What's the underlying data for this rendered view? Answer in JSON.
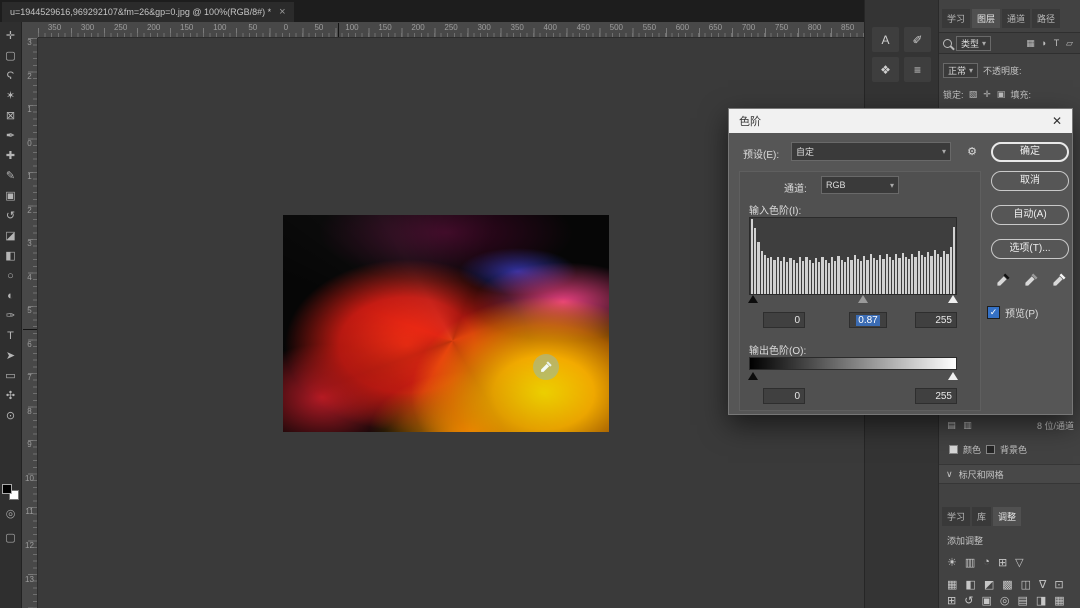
{
  "colors": {
    "accent_blue": "#3b6cb4",
    "dialog_bg": "#565656",
    "canvas_bg": "#3a3a3a"
  },
  "ui": {
    "dropdown_arrow": "▾",
    "check": "✓",
    "depth_icon1": "▤",
    "depth_icon2": "▥"
  },
  "window": {
    "doc_tab_title": "u=1944529616,969292107&fm=26&gp=0.jpg @ 100%(RGB/8#) *",
    "tab_close": "×"
  },
  "rulers": {
    "h_labels": [
      "350",
      "300",
      "250",
      "200",
      "150",
      "100",
      "50",
      "0",
      "50",
      "100",
      "150",
      "200",
      "250",
      "300",
      "350",
      "400",
      "450",
      "500",
      "550",
      "600",
      "650",
      "700",
      "750",
      "800",
      "850"
    ],
    "v_labels": [
      "3",
      "2",
      "1",
      "0",
      "1",
      "2",
      "3",
      "4",
      "5",
      "6",
      "7",
      "8",
      "9",
      "10",
      "11",
      "12",
      "13"
    ]
  },
  "toolbar": {
    "quick_mask_glyph": "◎",
    "screen_mode_glyph": "▢",
    "tools": [
      {
        "name": "move-tool-icon",
        "glyph": "✛"
      },
      {
        "name": "marquee-tool-icon",
        "glyph": "▢"
      },
      {
        "name": "lasso-tool-icon",
        "glyph": "Ϛ"
      },
      {
        "name": "quick-selection-tool-icon",
        "glyph": "✶"
      },
      {
        "name": "crop-tool-icon",
        "glyph": "⊠"
      },
      {
        "name": "eyedropper-tool-icon",
        "glyph": "✒"
      },
      {
        "name": "healing-brush-tool-icon",
        "glyph": "✚"
      },
      {
        "name": "brush-tool-icon",
        "glyph": "✎"
      },
      {
        "name": "clone-stamp-tool-icon",
        "glyph": "▣"
      },
      {
        "name": "history-brush-tool-icon",
        "glyph": "↺"
      },
      {
        "name": "eraser-tool-icon",
        "glyph": "◪"
      },
      {
        "name": "gradient-tool-icon",
        "glyph": "◧"
      },
      {
        "name": "blur-tool-icon",
        "glyph": "○"
      },
      {
        "name": "dodge-tool-icon",
        "glyph": "◐"
      },
      {
        "name": "pen-tool-icon",
        "glyph": "✑"
      },
      {
        "name": "type-tool-icon",
        "glyph": "T"
      },
      {
        "name": "path-selection-tool-icon",
        "glyph": "➤"
      },
      {
        "name": "shape-tool-icon",
        "glyph": "▭"
      },
      {
        "name": "hand-tool-icon",
        "glyph": "✣"
      },
      {
        "name": "zoom-tool-icon",
        "glyph": "⊙"
      }
    ]
  },
  "side_strip": {
    "icons": [
      {
        "name": "character-panel-icon",
        "glyph": "A"
      },
      {
        "name": "brush-settings-panel-icon",
        "glyph": "✐"
      },
      {
        "name": "3d-panel-icon",
        "glyph": "❖"
      },
      {
        "name": "properties-panel-icon",
        "glyph": "≡"
      }
    ]
  },
  "panels": {
    "top_tabs": [
      {
        "name": "tab-learn",
        "label": "学习"
      },
      {
        "name": "tab-layers",
        "label": "图层",
        "active": true
      },
      {
        "name": "tab-channels",
        "label": "通道"
      },
      {
        "name": "tab-paths",
        "label": "路径"
      }
    ],
    "filter_label": "类型",
    "filter_icons": [
      {
        "name": "filter-pixel-layers-icon",
        "glyph": "▦"
      },
      {
        "name": "filter-adjustment-layers-icon",
        "glyph": "◑"
      },
      {
        "name": "filter-type-layers-icon",
        "glyph": "T"
      },
      {
        "name": "filter-shape-layers-icon",
        "glyph": "▱"
      }
    ],
    "blend_mode": "正常",
    "opacity_label": "不透明度:",
    "lock_label": "锁定:",
    "lock_icons": [
      {
        "name": "lock-transparent-pixels-icon",
        "glyph": "▧"
      },
      {
        "name": "lock-position-icon",
        "glyph": "✛"
      },
      {
        "name": "lock-all-icon",
        "glyph": "▣"
      }
    ],
    "fill_label": "填充:",
    "bit_depth": "8 位/通道",
    "color_label": "颜色",
    "bg_color_label": "背景色",
    "chevron": "∨",
    "rulers_grid_label": "标尺和网格",
    "bottom_tabs": [
      {
        "name": "tab-learn-2",
        "label": "学习"
      },
      {
        "name": "tab-libraries",
        "label": "库"
      },
      {
        "name": "tab-adjustments",
        "label": "调整",
        "active": true
      }
    ],
    "add_adjustment_label": "添加调整",
    "adjustment_icons_row1": [
      {
        "name": "brightness-contrast-icon",
        "glyph": "☀"
      },
      {
        "name": "levels-adjustment-icon",
        "glyph": "▥"
      },
      {
        "name": "curves-adjustment-icon",
        "glyph": "◔"
      },
      {
        "name": "exposure-adjustment-icon",
        "glyph": "⊞"
      },
      {
        "name": "vibrance-adjustment-icon",
        "glyph": "▽"
      }
    ],
    "adjustment_icons_row2": [
      {
        "name": "hue-saturation-icon",
        "glyph": "▦"
      },
      {
        "name": "color-balance-icon",
        "glyph": "◧"
      },
      {
        "name": "black-white-icon",
        "glyph": "◩"
      },
      {
        "name": "photo-filter-icon",
        "glyph": "▩"
      },
      {
        "name": "channel-mixer-icon",
        "glyph": "◫"
      },
      {
        "name": "gradient-map-icon",
        "glyph": "∇"
      },
      {
        "name": "selective-color-icon",
        "glyph": "⊡"
      }
    ],
    "panel_action_icons": [
      {
        "name": "link-layers-icon",
        "glyph": "⊞"
      },
      {
        "name": "layer-effects-icon",
        "glyph": "↺"
      },
      {
        "name": "layer-mask-icon",
        "glyph": "▣"
      },
      {
        "name": "new-adjustment-layer-icon",
        "glyph": "◎"
      },
      {
        "name": "layer-group-icon",
        "glyph": "▤"
      },
      {
        "name": "new-layer-icon",
        "glyph": "◨"
      },
      {
        "name": "delete-layer-icon",
        "glyph": "▦"
      }
    ]
  },
  "dialog": {
    "title": "色阶",
    "close": "✕",
    "preset_label": "预设(E):",
    "preset_value": "自定",
    "gear_icon": "⚙",
    "channel_label": "通道:",
    "channel_value": "RGB",
    "input_label": "输入色阶(I):",
    "input_black": "0",
    "input_gamma": "0.87",
    "input_white": "255",
    "output_label": "输出色阶(O):",
    "output_black": "0",
    "output_white": "255",
    "ok": "确定",
    "cancel": "取消",
    "auto": "自动(A)",
    "options": "选项(T)...",
    "preview_label": "预览(P)",
    "gamma_slider_pos": 0.55,
    "histogram": [
      1,
      0.88,
      0.7,
      0.58,
      0.52,
      0.48,
      0.5,
      0.45,
      0.49,
      0.44,
      0.5,
      0.43,
      0.48,
      0.45,
      0.41,
      0.49,
      0.44,
      0.5,
      0.45,
      0.41,
      0.48,
      0.43,
      0.5,
      0.46,
      0.42,
      0.49,
      0.44,
      0.51,
      0.46,
      0.43,
      0.5,
      0.45,
      0.52,
      0.47,
      0.44,
      0.51,
      0.46,
      0.53,
      0.48,
      0.45,
      0.52,
      0.47,
      0.54,
      0.49,
      0.46,
      0.53,
      0.48,
      0.55,
      0.5,
      0.47,
      0.54,
      0.49,
      0.57,
      0.52,
      0.49,
      0.56,
      0.51,
      0.59,
      0.53,
      0.5,
      0.58,
      0.54,
      0.63,
      0.9
    ]
  }
}
